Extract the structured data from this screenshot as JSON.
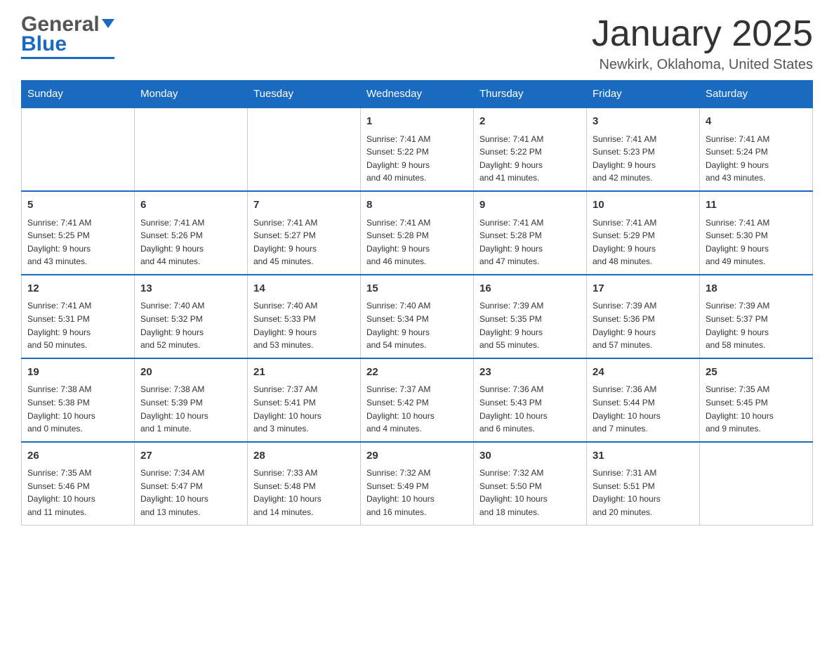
{
  "header": {
    "logo_general": "General",
    "logo_blue": "Blue",
    "title": "January 2025",
    "subtitle": "Newkirk, Oklahoma, United States"
  },
  "days_of_week": [
    "Sunday",
    "Monday",
    "Tuesday",
    "Wednesday",
    "Thursday",
    "Friday",
    "Saturday"
  ],
  "weeks": [
    [
      {
        "day": "",
        "info": ""
      },
      {
        "day": "",
        "info": ""
      },
      {
        "day": "",
        "info": ""
      },
      {
        "day": "1",
        "info": "Sunrise: 7:41 AM\nSunset: 5:22 PM\nDaylight: 9 hours\nand 40 minutes."
      },
      {
        "day": "2",
        "info": "Sunrise: 7:41 AM\nSunset: 5:22 PM\nDaylight: 9 hours\nand 41 minutes."
      },
      {
        "day": "3",
        "info": "Sunrise: 7:41 AM\nSunset: 5:23 PM\nDaylight: 9 hours\nand 42 minutes."
      },
      {
        "day": "4",
        "info": "Sunrise: 7:41 AM\nSunset: 5:24 PM\nDaylight: 9 hours\nand 43 minutes."
      }
    ],
    [
      {
        "day": "5",
        "info": "Sunrise: 7:41 AM\nSunset: 5:25 PM\nDaylight: 9 hours\nand 43 minutes."
      },
      {
        "day": "6",
        "info": "Sunrise: 7:41 AM\nSunset: 5:26 PM\nDaylight: 9 hours\nand 44 minutes."
      },
      {
        "day": "7",
        "info": "Sunrise: 7:41 AM\nSunset: 5:27 PM\nDaylight: 9 hours\nand 45 minutes."
      },
      {
        "day": "8",
        "info": "Sunrise: 7:41 AM\nSunset: 5:28 PM\nDaylight: 9 hours\nand 46 minutes."
      },
      {
        "day": "9",
        "info": "Sunrise: 7:41 AM\nSunset: 5:28 PM\nDaylight: 9 hours\nand 47 minutes."
      },
      {
        "day": "10",
        "info": "Sunrise: 7:41 AM\nSunset: 5:29 PM\nDaylight: 9 hours\nand 48 minutes."
      },
      {
        "day": "11",
        "info": "Sunrise: 7:41 AM\nSunset: 5:30 PM\nDaylight: 9 hours\nand 49 minutes."
      }
    ],
    [
      {
        "day": "12",
        "info": "Sunrise: 7:41 AM\nSunset: 5:31 PM\nDaylight: 9 hours\nand 50 minutes."
      },
      {
        "day": "13",
        "info": "Sunrise: 7:40 AM\nSunset: 5:32 PM\nDaylight: 9 hours\nand 52 minutes."
      },
      {
        "day": "14",
        "info": "Sunrise: 7:40 AM\nSunset: 5:33 PM\nDaylight: 9 hours\nand 53 minutes."
      },
      {
        "day": "15",
        "info": "Sunrise: 7:40 AM\nSunset: 5:34 PM\nDaylight: 9 hours\nand 54 minutes."
      },
      {
        "day": "16",
        "info": "Sunrise: 7:39 AM\nSunset: 5:35 PM\nDaylight: 9 hours\nand 55 minutes."
      },
      {
        "day": "17",
        "info": "Sunrise: 7:39 AM\nSunset: 5:36 PM\nDaylight: 9 hours\nand 57 minutes."
      },
      {
        "day": "18",
        "info": "Sunrise: 7:39 AM\nSunset: 5:37 PM\nDaylight: 9 hours\nand 58 minutes."
      }
    ],
    [
      {
        "day": "19",
        "info": "Sunrise: 7:38 AM\nSunset: 5:38 PM\nDaylight: 10 hours\nand 0 minutes."
      },
      {
        "day": "20",
        "info": "Sunrise: 7:38 AM\nSunset: 5:39 PM\nDaylight: 10 hours\nand 1 minute."
      },
      {
        "day": "21",
        "info": "Sunrise: 7:37 AM\nSunset: 5:41 PM\nDaylight: 10 hours\nand 3 minutes."
      },
      {
        "day": "22",
        "info": "Sunrise: 7:37 AM\nSunset: 5:42 PM\nDaylight: 10 hours\nand 4 minutes."
      },
      {
        "day": "23",
        "info": "Sunrise: 7:36 AM\nSunset: 5:43 PM\nDaylight: 10 hours\nand 6 minutes."
      },
      {
        "day": "24",
        "info": "Sunrise: 7:36 AM\nSunset: 5:44 PM\nDaylight: 10 hours\nand 7 minutes."
      },
      {
        "day": "25",
        "info": "Sunrise: 7:35 AM\nSunset: 5:45 PM\nDaylight: 10 hours\nand 9 minutes."
      }
    ],
    [
      {
        "day": "26",
        "info": "Sunrise: 7:35 AM\nSunset: 5:46 PM\nDaylight: 10 hours\nand 11 minutes."
      },
      {
        "day": "27",
        "info": "Sunrise: 7:34 AM\nSunset: 5:47 PM\nDaylight: 10 hours\nand 13 minutes."
      },
      {
        "day": "28",
        "info": "Sunrise: 7:33 AM\nSunset: 5:48 PM\nDaylight: 10 hours\nand 14 minutes."
      },
      {
        "day": "29",
        "info": "Sunrise: 7:32 AM\nSunset: 5:49 PM\nDaylight: 10 hours\nand 16 minutes."
      },
      {
        "day": "30",
        "info": "Sunrise: 7:32 AM\nSunset: 5:50 PM\nDaylight: 10 hours\nand 18 minutes."
      },
      {
        "day": "31",
        "info": "Sunrise: 7:31 AM\nSunset: 5:51 PM\nDaylight: 10 hours\nand 20 minutes."
      },
      {
        "day": "",
        "info": ""
      }
    ]
  ]
}
